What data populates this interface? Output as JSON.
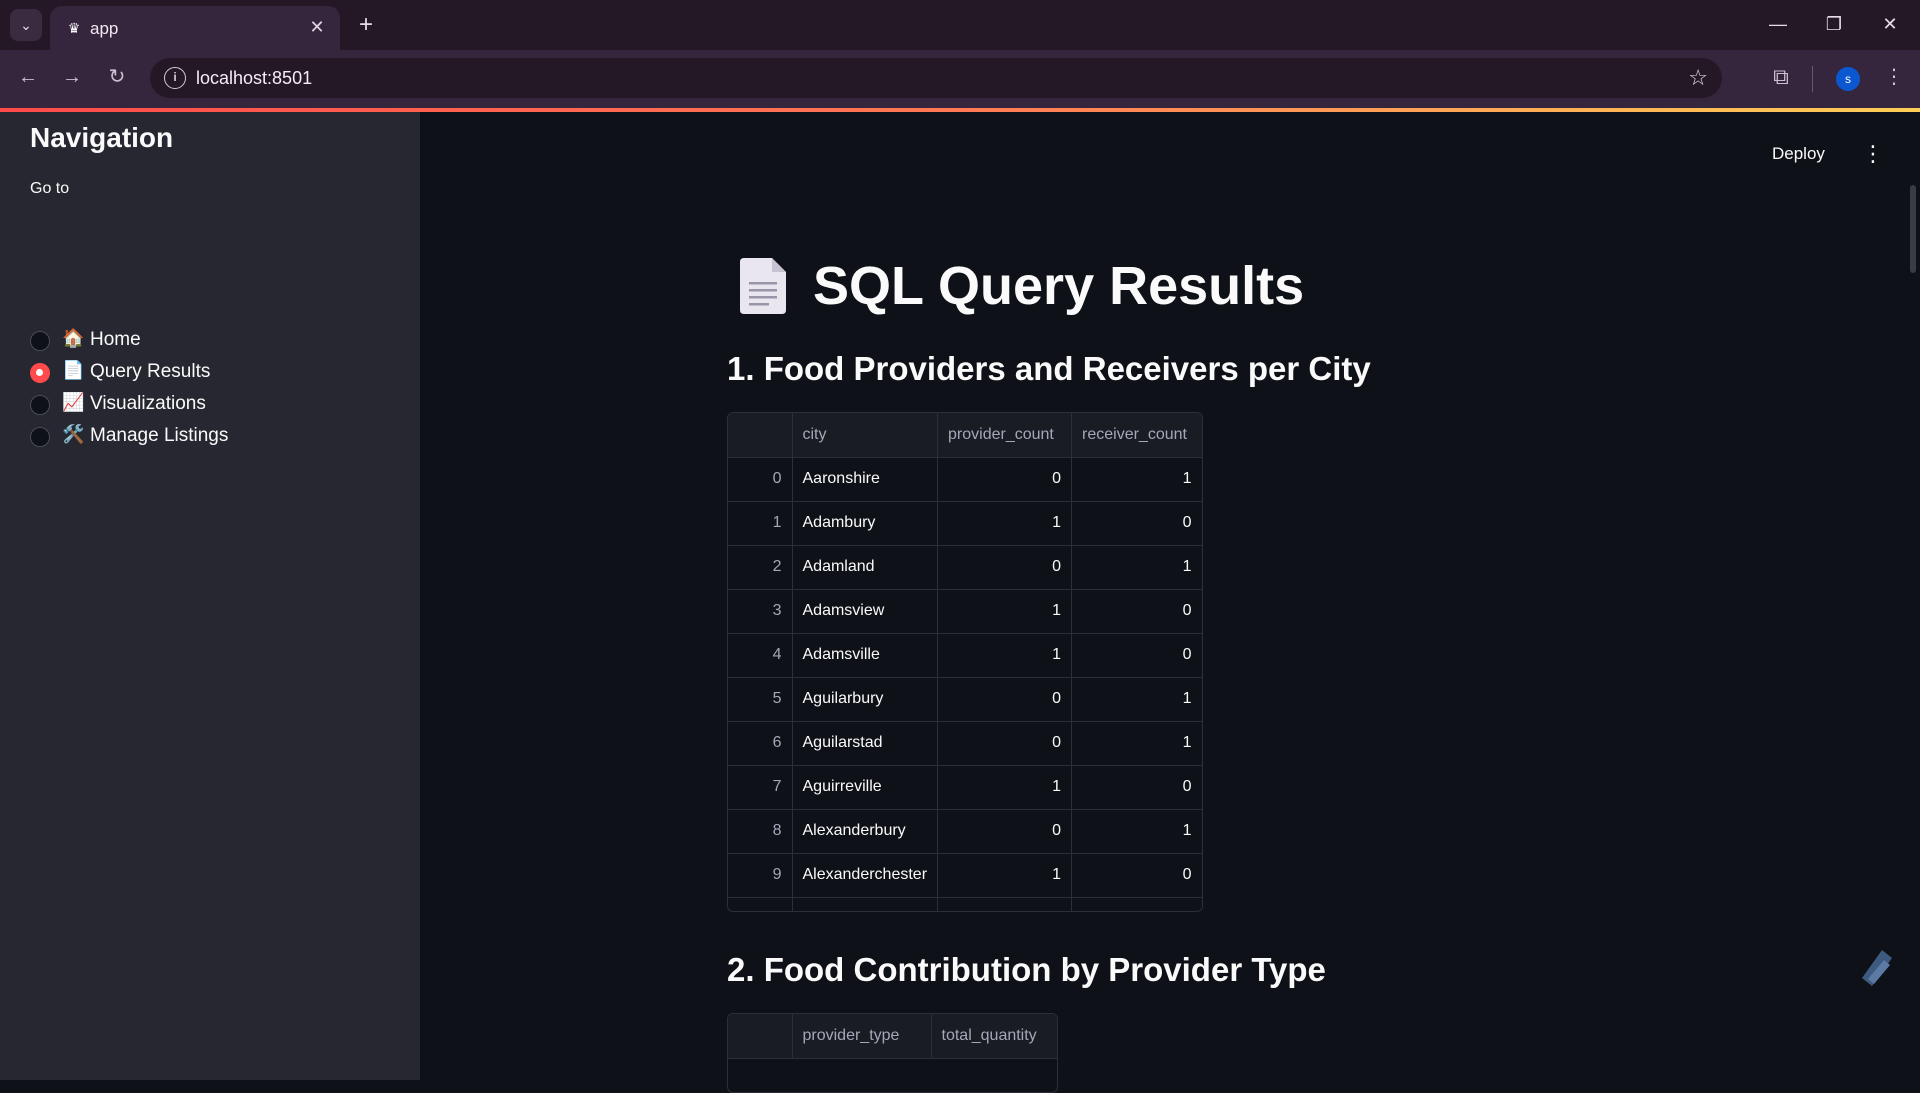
{
  "browser": {
    "tab_title": "app",
    "url": "localhost:8501",
    "avatar_letter": "s"
  },
  "sidebar": {
    "title": "Navigation",
    "goto_label": "Go to",
    "items": [
      {
        "icon": "🏠",
        "label": "Home",
        "selected": false
      },
      {
        "icon": "📄",
        "label": "Query Results",
        "selected": true
      },
      {
        "icon": "📈",
        "label": "Visualizations",
        "selected": false
      },
      {
        "icon": "🛠️",
        "label": "Manage Listings",
        "selected": false
      }
    ]
  },
  "header": {
    "deploy_label": "Deploy"
  },
  "main": {
    "title": "SQL Query Results",
    "sections": [
      {
        "heading": "1. Food Providers and Receivers per City",
        "columns": [
          "city",
          "provider_count",
          "receiver_count"
        ],
        "rows": [
          [
            "0",
            "Aaronshire",
            "0",
            "1"
          ],
          [
            "1",
            "Adambury",
            "1",
            "0"
          ],
          [
            "2",
            "Adamland",
            "0",
            "1"
          ],
          [
            "3",
            "Adamsview",
            "1",
            "0"
          ],
          [
            "4",
            "Adamsville",
            "1",
            "0"
          ],
          [
            "5",
            "Aguilarbury",
            "0",
            "1"
          ],
          [
            "6",
            "Aguilarstad",
            "0",
            "1"
          ],
          [
            "7",
            "Aguirreville",
            "1",
            "0"
          ],
          [
            "8",
            "Alexanderbury",
            "0",
            "1"
          ],
          [
            "9",
            "Alexanderchester",
            "1",
            "0"
          ]
        ]
      },
      {
        "heading": "2. Food Contribution by Provider Type",
        "columns": [
          "provider_type",
          "total_quantity"
        ]
      }
    ]
  },
  "colors": {
    "accent": "#ff4b4b",
    "sidebar_bg": "#262730",
    "main_bg": "#0e1117",
    "browser_frame": "#35263d"
  }
}
